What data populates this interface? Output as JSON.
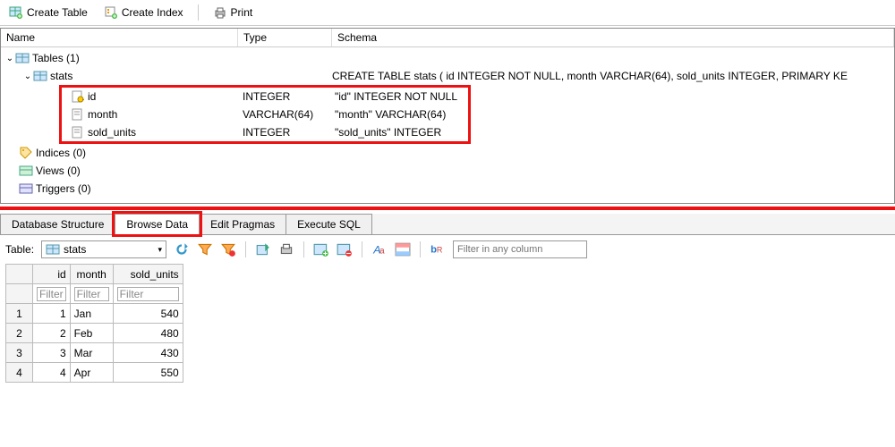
{
  "toolbar": {
    "create_table": "Create Table",
    "create_index": "Create Index",
    "print": "Print"
  },
  "tree": {
    "headers": {
      "name": "Name",
      "type": "Type",
      "schema": "Schema"
    },
    "tables_group": "Tables (1)",
    "table_name": "stats",
    "table_schema": "CREATE TABLE stats ( id INTEGER NOT NULL, month VARCHAR(64), sold_units INTEGER, PRIMARY KE",
    "columns": [
      {
        "name": "id",
        "type": "INTEGER",
        "schema": "\"id\" INTEGER NOT NULL"
      },
      {
        "name": "month",
        "type": "VARCHAR(64)",
        "schema": "\"month\" VARCHAR(64)"
      },
      {
        "name": "sold_units",
        "type": "INTEGER",
        "schema": "\"sold_units\" INTEGER"
      }
    ],
    "indices_group": "Indices (0)",
    "views_group": "Views (0)",
    "triggers_group": "Triggers (0)"
  },
  "tabs": {
    "structure": "Database Structure",
    "browse": "Browse Data",
    "pragmas": "Edit Pragmas",
    "sql": "Execute SQL"
  },
  "browse": {
    "table_label": "Table:",
    "selected_table": "stats",
    "filter_placeholder": "Filter in any column",
    "col_filter": "Filter",
    "headers": {
      "id": "id",
      "month": "month",
      "sold": "sold_units"
    },
    "rows": [
      {
        "n": "1",
        "id": "1",
        "month": "Jan",
        "sold": "540"
      },
      {
        "n": "2",
        "id": "2",
        "month": "Feb",
        "sold": "480"
      },
      {
        "n": "3",
        "id": "3",
        "month": "Mar",
        "sold": "430"
      },
      {
        "n": "4",
        "id": "4",
        "month": "Apr",
        "sold": "550"
      }
    ]
  }
}
